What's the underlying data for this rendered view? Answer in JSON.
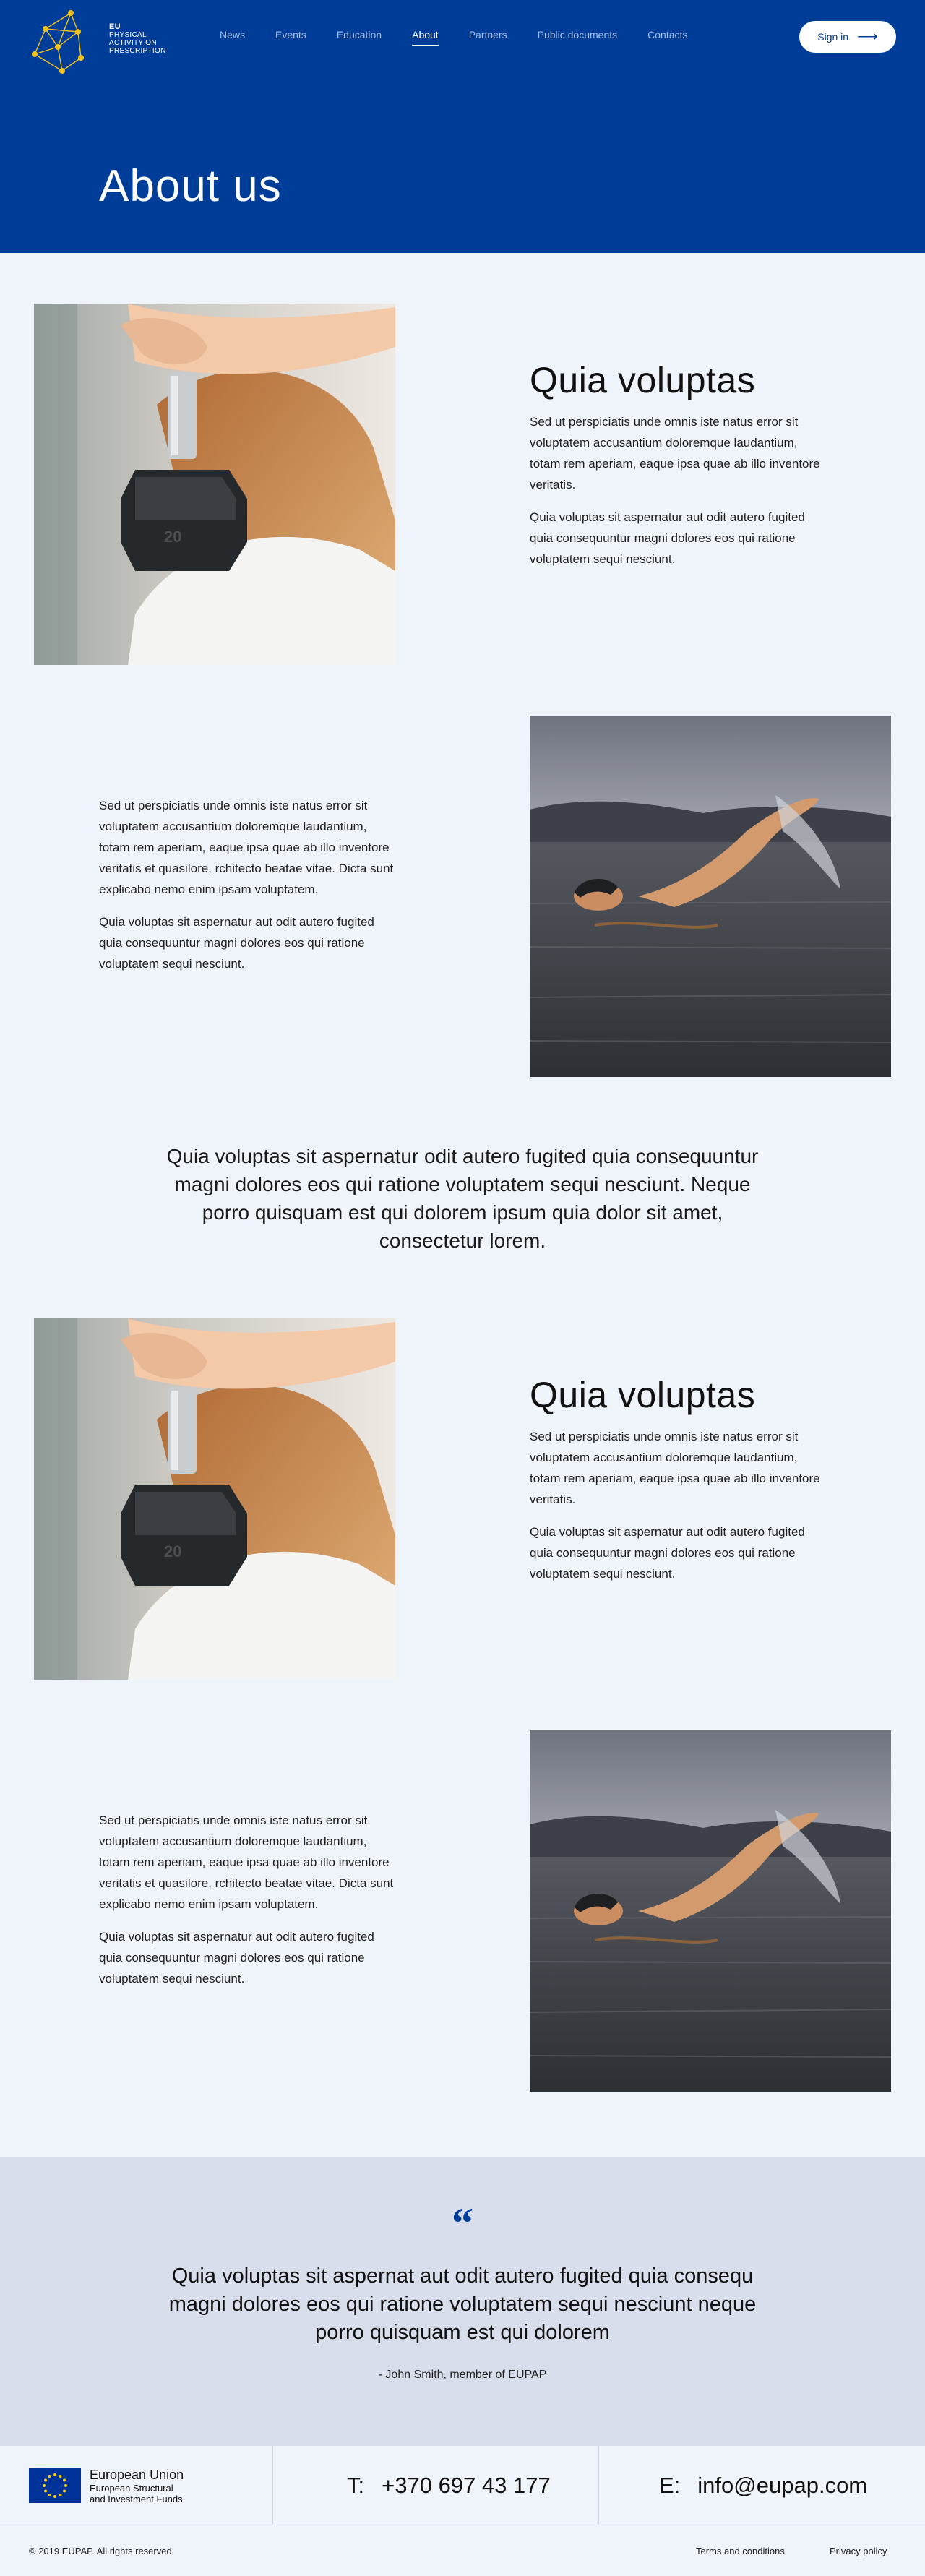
{
  "brand": {
    "line1": "EU",
    "line2": "PHYSICAL",
    "line3": "ACTIVITY ON",
    "line4": "PRESCRIPTION"
  },
  "nav": {
    "items": [
      {
        "label": "News"
      },
      {
        "label": "Events"
      },
      {
        "label": "Education"
      },
      {
        "label": "About"
      },
      {
        "label": "Partners"
      },
      {
        "label": "Public documents"
      },
      {
        "label": "Contacts"
      }
    ],
    "active": "About"
  },
  "signin": {
    "label": "Sign in",
    "icon": "arrow-right-icon"
  },
  "hero": {
    "title": "About us"
  },
  "section1": {
    "heading": "Quia voluptas",
    "p1": "Sed ut perspiciatis unde omnis iste natus error sit voluptatem accusantium doloremque laudantium, totam rem aperiam, eaque ipsa quae ab illo inventore veritatis.",
    "p2": "Quia voluptas sit aspernatur aut odit autero fugited quia consequuntur magni dolores eos qui ratione voluptatem sequi nesciunt."
  },
  "section2": {
    "p1": "Sed ut perspiciatis unde omnis iste natus error sit voluptatem accusantium doloremque laudantium, totam rem aperiam, eaque ipsa quae ab illo inventore veritatis et quasilore, rchitecto beatae vitae. Dicta sunt explicabo nemo enim ipsam voluptatem.",
    "p2": "Quia voluptas sit aspernatur aut odit autero fugited quia consequuntur magni dolores eos qui ratione voluptatem sequi nesciunt."
  },
  "center_quote": "Quia voluptas sit aspernatur odit autero fugited quia consequuntur magni dolores eos qui ratione voluptatem sequi nesciunt. Neque porro quisquam est qui dolorem ipsum quia dolor sit amet, consectetur lorem.",
  "section3": {
    "heading": "Quia voluptas",
    "p1": "Sed ut perspiciatis unde omnis iste natus error sit voluptatem accusantium doloremque laudantium, totam rem aperiam, eaque ipsa quae ab illo inventore veritatis.",
    "p2": "Quia voluptas sit aspernatur aut odit autero fugited quia consequuntur magni dolores eos qui ratione voluptatem sequi nesciunt."
  },
  "section4": {
    "p1": "Sed ut perspiciatis unde omnis iste natus error sit voluptatem accusantium doloremque laudantium, totam rem aperiam, eaque ipsa quae ab illo inventore veritatis et quasilore, rchitecto beatae vitae. Dicta sunt explicabo nemo enim ipsam voluptatem.",
    "p2": "Quia voluptas sit aspernatur aut odit autero fugited quia consequuntur magni dolores eos qui ratione voluptatem sequi nesciunt."
  },
  "testimonial": {
    "mark": "“",
    "text": "Quia voluptas sit aspernat aut odit autero fugited quia consequ magni dolores eos qui ratione voluptatem sequi nesciunt neque porro quisquam est qui dolorem",
    "author": "- John Smith, member of EUPAP"
  },
  "footer": {
    "eu_title": "European Union",
    "eu_sub1": "European Structural",
    "eu_sub2": "and Investment Funds",
    "phone_label": "T:",
    "phone": "+370 697 43 177",
    "email_label": "E:",
    "email": "info@eupap.com",
    "copyright": "© 2019 EUPAP. All rights reserved",
    "terms": "Terms and conditions",
    "privacy": "Privacy policy"
  },
  "colors": {
    "brand_blue": "#003d99",
    "page_bg": "#eff3fa",
    "testimonial_bg": "#d8deeb",
    "logo_dot": "#f2c21b"
  }
}
